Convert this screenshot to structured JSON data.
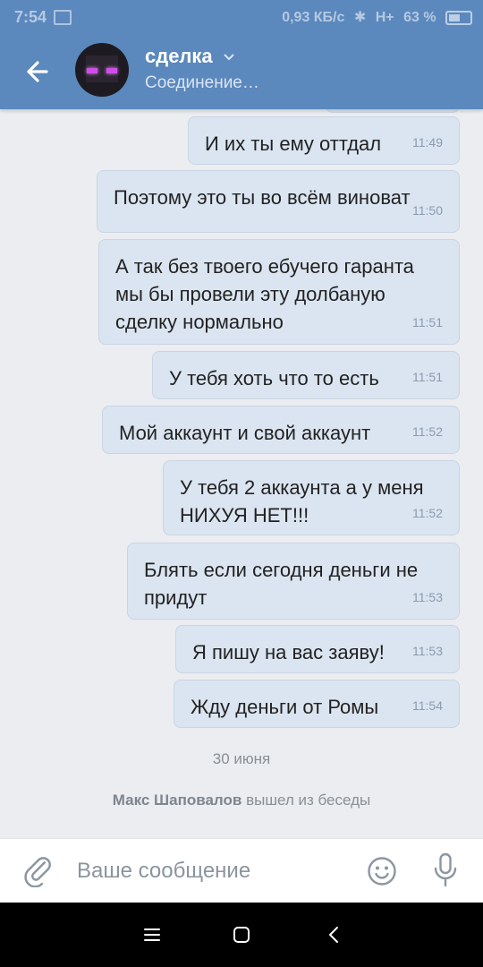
{
  "status_bar": {
    "time": "7:54",
    "speed": "0,93 КБ/с",
    "network": "H+",
    "battery": "63 %"
  },
  "header": {
    "title": "сделка",
    "status": "Соединение…"
  },
  "messages": [
    {
      "text": "И их ты ему оттдал",
      "time": "11:49"
    },
    {
      "text": "Поэтому это ты во всём виноват",
      "time": "11:50"
    },
    {
      "text": "А так без твоего ебучего гаранта\nмы бы провели эту долбаную\nсделку нормально",
      "time": "11:51"
    },
    {
      "text": "У тебя хоть что то есть",
      "time": "11:51"
    },
    {
      "text": "Мой аккаунт и свой аккаунт",
      "time": "11:52"
    },
    {
      "text": "У тебя 2 аккаунта а у меня\nНИХУЯ НЕТ!!!",
      "time": "11:52"
    },
    {
      "text": "Блять если сегодня деньги не\nпридут",
      "time": "11:53"
    },
    {
      "text": "Я пишу на вас заяву!",
      "time": "11:53"
    },
    {
      "text": "Жду деньги от Ромы",
      "time": "11:54"
    }
  ],
  "date_separator": "30 июня",
  "service_message": {
    "name": "Макс Шаповалов",
    "action": "вышел из беседы"
  },
  "composer": {
    "placeholder": "Ваше сообщение",
    "value": ""
  },
  "icons": {
    "back": "arrow-left-icon",
    "attach": "paperclip-icon",
    "emoji": "smiley-icon",
    "mic": "microphone-icon",
    "nav_menu": "menu-icon",
    "nav_home": "square-icon",
    "nav_back": "chevron-left-icon"
  },
  "colors": {
    "header": "#5b88bd",
    "bubble": "#dbe5f1",
    "background": "#ebedf0"
  }
}
